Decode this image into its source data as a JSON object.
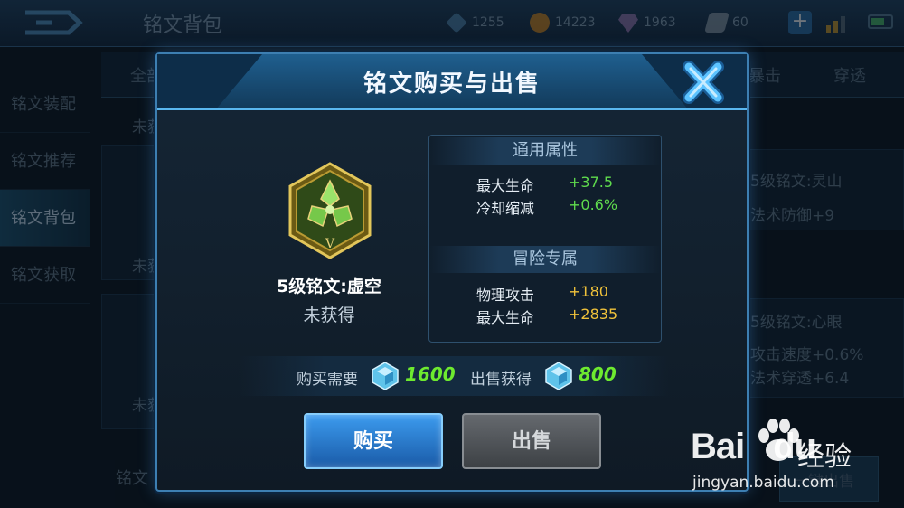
{
  "topbar": {
    "title": "铭文背包",
    "resources": [
      {
        "icon": "crystal-icon",
        "value": "1255"
      },
      {
        "icon": "gold-coin-icon",
        "value": "14223"
      },
      {
        "icon": "gem-icon",
        "value": "1963"
      },
      {
        "icon": "ticket-icon",
        "value": "60"
      }
    ],
    "plus_label": "+"
  },
  "side_nav": [
    "铭文装配",
    "铭文推荐",
    "铭文背包",
    "铭文获取"
  ],
  "background": {
    "tab_all": "全部",
    "tab_crit": "暴击",
    "tab_pierce": "穿透",
    "item_status_1": "未获",
    "item_status_2": "未获",
    "item_status_3": "未获",
    "right_item_1_name": "5级铭文:灵山",
    "right_item_1_stat": "法术防御+9",
    "right_item_2_name": "5级铭文:心眼",
    "right_item_2_stat_1": "攻击速度+0.6%",
    "right_item_2_stat_2": "法术穿透+6.4",
    "bottom_label": "铭文",
    "bottom_right_label": "一键出售"
  },
  "modal": {
    "title": "铭文购买与出售",
    "rune": {
      "name": "5级铭文:虚空",
      "status": "未获得",
      "level_mark": "V"
    },
    "general": {
      "header": "通用属性",
      "stats": [
        {
          "label": "最大生命",
          "value": "+37.5"
        },
        {
          "label": "冷却缩减",
          "value": "+0.6%"
        }
      ]
    },
    "adventure": {
      "header": "冒险专属",
      "stats": [
        {
          "label": "物理攻击",
          "value": "+180"
        },
        {
          "label": "最大生命",
          "value": "+2835"
        }
      ]
    },
    "price": {
      "buy_label": "购买需要",
      "buy_value": "1600",
      "sell_label": "出售获得",
      "sell_value": "800"
    },
    "buttons": {
      "buy": "购买",
      "sell": "出售"
    },
    "colors": {
      "positive": "#5fdb4d",
      "adventure": "#f0c23a",
      "price": "#6eea2f"
    }
  },
  "watermark": {
    "logo_text": "Bai",
    "logo_text2": "du",
    "cn_text": "经验",
    "url": "jingyan.baidu.com"
  }
}
